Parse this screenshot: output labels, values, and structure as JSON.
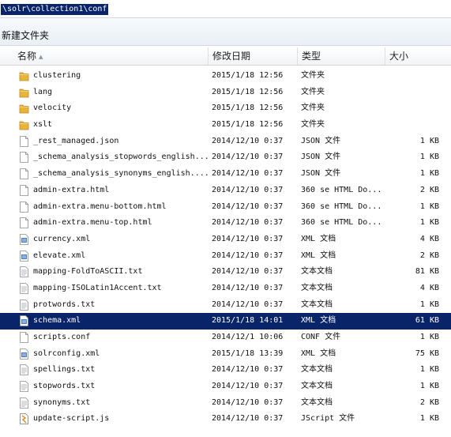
{
  "address_bar": {
    "path": "\\solr\\collection1\\conf"
  },
  "toolbar": {
    "new_folder_label": "新建文件夹"
  },
  "columns": {
    "name": "名称",
    "modified": "修改日期",
    "type": "类型",
    "size": "大小"
  },
  "colors": {
    "selection": "#0a246a",
    "folder": "#e8b53a"
  },
  "files": [
    {
      "name": "clustering",
      "modified": "2015/1/18 12:56",
      "type": "文件夹",
      "size": "",
      "icon": "folder-icon"
    },
    {
      "name": "lang",
      "modified": "2015/1/18 12:56",
      "type": "文件夹",
      "size": "",
      "icon": "folder-icon"
    },
    {
      "name": "velocity",
      "modified": "2015/1/18 12:56",
      "type": "文件夹",
      "size": "",
      "icon": "folder-icon"
    },
    {
      "name": "xslt",
      "modified": "2015/1/18 12:56",
      "type": "文件夹",
      "size": "",
      "icon": "folder-icon"
    },
    {
      "name": "_rest_managed.json",
      "modified": "2014/12/10 0:37",
      "type": "JSON 文件",
      "size": "1 KB",
      "icon": "file-icon"
    },
    {
      "name": "_schema_analysis_stopwords_english...",
      "modified": "2014/12/10 0:37",
      "type": "JSON 文件",
      "size": "1 KB",
      "icon": "file-icon"
    },
    {
      "name": "_schema_analysis_synonyms_english....",
      "modified": "2014/12/10 0:37",
      "type": "JSON 文件",
      "size": "1 KB",
      "icon": "file-icon"
    },
    {
      "name": "admin-extra.html",
      "modified": "2014/12/10 0:37",
      "type": "360 se HTML Do...",
      "size": "2 KB",
      "icon": "file-icon"
    },
    {
      "name": "admin-extra.menu-bottom.html",
      "modified": "2014/12/10 0:37",
      "type": "360 se HTML Do...",
      "size": "1 KB",
      "icon": "file-icon"
    },
    {
      "name": "admin-extra.menu-top.html",
      "modified": "2014/12/10 0:37",
      "type": "360 se HTML Do...",
      "size": "1 KB",
      "icon": "file-icon"
    },
    {
      "name": "currency.xml",
      "modified": "2014/12/10 0:37",
      "type": "XML 文档",
      "size": "4 KB",
      "icon": "xml-file-icon"
    },
    {
      "name": "elevate.xml",
      "modified": "2014/12/10 0:37",
      "type": "XML 文档",
      "size": "2 KB",
      "icon": "xml-file-icon"
    },
    {
      "name": "mapping-FoldToASCII.txt",
      "modified": "2014/12/10 0:37",
      "type": "文本文档",
      "size": "81 KB",
      "icon": "text-file-icon"
    },
    {
      "name": "mapping-ISOLatin1Accent.txt",
      "modified": "2014/12/10 0:37",
      "type": "文本文档",
      "size": "4 KB",
      "icon": "text-file-icon"
    },
    {
      "name": "protwords.txt",
      "modified": "2014/12/10 0:37",
      "type": "文本文档",
      "size": "1 KB",
      "icon": "text-file-icon"
    },
    {
      "name": "schema.xml",
      "modified": "2015/1/18 14:01",
      "type": "XML 文档",
      "size": "61 KB",
      "icon": "xml-file-icon",
      "selected": true
    },
    {
      "name": "scripts.conf",
      "modified": "2014/12/1 10:06",
      "type": "CONF 文件",
      "size": "1 KB",
      "icon": "file-icon"
    },
    {
      "name": "solrconfig.xml",
      "modified": "2015/1/18 13:39",
      "type": "XML 文档",
      "size": "75 KB",
      "icon": "xml-file-icon"
    },
    {
      "name": "spellings.txt",
      "modified": "2014/12/10 0:37",
      "type": "文本文档",
      "size": "1 KB",
      "icon": "text-file-icon"
    },
    {
      "name": "stopwords.txt",
      "modified": "2014/12/10 0:37",
      "type": "文本文档",
      "size": "1 KB",
      "icon": "text-file-icon"
    },
    {
      "name": "synonyms.txt",
      "modified": "2014/12/10 0:37",
      "type": "文本文档",
      "size": "2 KB",
      "icon": "text-file-icon"
    },
    {
      "name": "update-script.js",
      "modified": "2014/12/10 0:37",
      "type": "JScript 文件",
      "size": "1 KB",
      "icon": "js-file-icon"
    }
  ]
}
